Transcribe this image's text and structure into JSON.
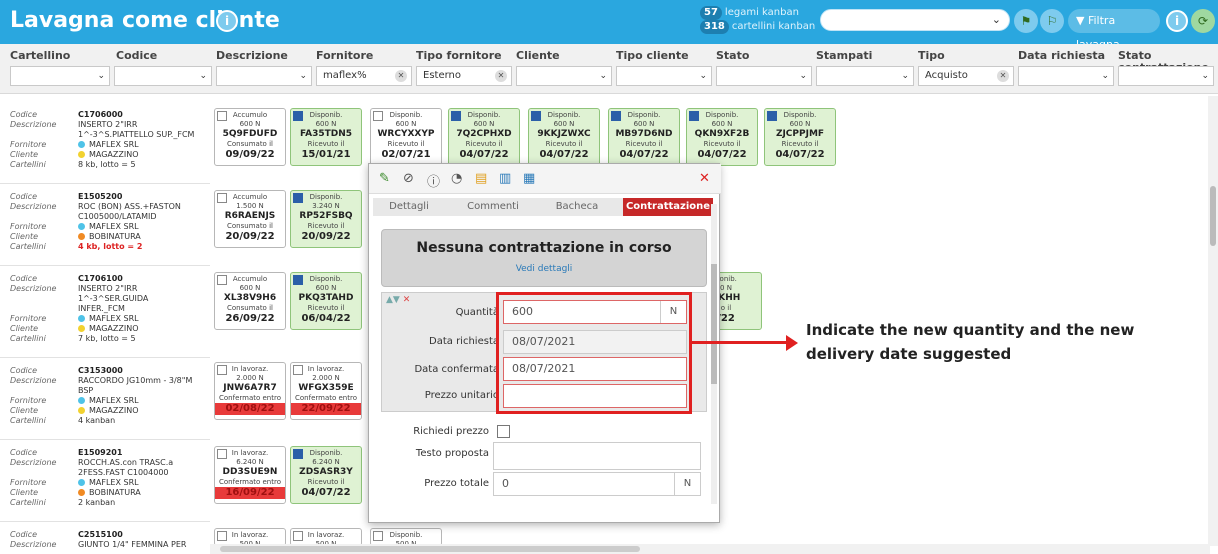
{
  "header": {
    "title": "Lavagna come cliente",
    "legami_count": "57",
    "legami_label": "legami kanban",
    "cartellini_count": "318",
    "cartellini_label": "cartellini kanban",
    "filter_button": "Filtra lavagna"
  },
  "filters": {
    "columns": [
      "Cartellino",
      "Codice",
      "Descrizione",
      "Fornitore",
      "Tipo fornitore",
      "Cliente",
      "Tipo cliente",
      "Stato",
      "Stampati",
      "Tipo",
      "Data richiesta",
      "Stato contrattazione"
    ],
    "values": {
      "fornitore": "maflex%",
      "tipo_fornitore": "Esterno",
      "tipo": "Acquisto"
    }
  },
  "labels": {
    "codice": "Codice",
    "descrizione": "Descrizione",
    "fornitore": "Fornitore",
    "cliente": "Cliente",
    "cartellini": "Cartellini"
  },
  "parts": [
    {
      "code": "C1706000",
      "desc1": "INSERTO 2\"IRR",
      "desc2": "1^-3^S.PIATTELLO SUP._FCM",
      "fornitore": "MAFLEX SRL",
      "cliente": "MAGAZZINO",
      "cliente_color": "#f2d230",
      "cartellini": "8 kb, lotto = 5",
      "cart_red": false
    },
    {
      "code": "E1505200",
      "desc1": "ROC (BON) ASS.+FASTON",
      "desc2": "C1005000/LATAMID",
      "fornitore": "MAFLEX SRL",
      "cliente": "BOBINATURA",
      "cliente_color": "#f08a24",
      "cartellini": "4 kb, lotto = 2",
      "cart_red": true
    },
    {
      "code": "C1706100",
      "desc1": "INSERTO 2\"IRR",
      "desc2": "1^-3^SER.GUIDA",
      "desc3": "INFER._FCM",
      "fornitore": "MAFLEX SRL",
      "cliente": "MAGAZZINO",
      "cliente_color": "#f2d230",
      "cartellini": "7 kb, lotto = 5",
      "cart_red": false
    },
    {
      "code": "C3153000",
      "desc1": "RACCORDO JG10mm - 3/8\"M",
      "desc2": "BSP",
      "fornitore": "MAFLEX SRL",
      "cliente": "MAGAZZINO",
      "cliente_color": "#f2d230",
      "cartellini": "4 kanban",
      "cart_red": false
    },
    {
      "code": "E1509201",
      "desc1": "ROCCH.AS.con TRASC.a",
      "desc2": "2FESS.FAST C1004000",
      "fornitore": "MAFLEX SRL",
      "cliente": "BOBINATURA",
      "cliente_color": "#f08a24",
      "cartellini": "2 kanban",
      "cart_red": false
    },
    {
      "code": "C2515100",
      "desc1": "GIUNTO 1/4\" FEMMINA PER"
    }
  ],
  "cards_row1": [
    {
      "status": "Accumulo",
      "qty": "600 N",
      "code": "5Q9FDUFD",
      "sub": "Consumato il",
      "date": "09/09/22",
      "style": "white"
    },
    {
      "status": "Disponib.",
      "qty": "600 N",
      "code": "FA35TDN5",
      "sub": "Ricevuto il",
      "date": "15/01/21",
      "style": "green"
    },
    {
      "status": "Disponib.",
      "qty": "600 N",
      "code": "WRCYXXYP",
      "sub": "Ricevuto il",
      "date": "02/07/21",
      "style": "white"
    },
    {
      "status": "Disponib.",
      "qty": "600 N",
      "code": "7Q2CPHXD",
      "sub": "Ricevuto il",
      "date": "04/07/22",
      "style": "green"
    },
    {
      "status": "Disponib.",
      "qty": "600 N",
      "code": "9KKJZWXC",
      "sub": "Ricevuto il",
      "date": "04/07/22",
      "style": "green"
    },
    {
      "status": "Disponib.",
      "qty": "600 N",
      "code": "MB97D6ND",
      "sub": "Ricevuto il",
      "date": "04/07/22",
      "style": "green"
    },
    {
      "status": "Disponib.",
      "qty": "600 N",
      "code": "QKN9XF2B",
      "sub": "Ricevuto il",
      "date": "04/07/22",
      "style": "green"
    },
    {
      "status": "Disponib.",
      "qty": "600 N",
      "code": "ZJCPPJMF",
      "sub": "Ricevuto il",
      "date": "04/07/22",
      "style": "green"
    }
  ],
  "cards_row2": [
    {
      "status": "Accumulo",
      "qty": "1.500 N",
      "code": "R6RAENJS",
      "sub": "Consumato il",
      "date": "20/09/22",
      "style": "white"
    },
    {
      "status": "Disponib.",
      "qty": "3.240 N",
      "code": "RP52FSBQ",
      "sub": "Ricevuto il",
      "date": "20/09/22",
      "style": "green"
    }
  ],
  "cards_row3": [
    {
      "status": "Accumulo",
      "qty": "600 N",
      "code": "XL38V9H6",
      "sub": "Consumato il",
      "date": "26/09/22",
      "style": "white"
    },
    {
      "status": "Disponib.",
      "qty": "600 N",
      "code": "PKQ3TAHD",
      "sub": "Ricevuto il",
      "date": "06/04/22",
      "style": "green"
    },
    {
      "status": "ponib.",
      "qty": "0 N",
      "code": "YKHH",
      "sub": "o il",
      "date": "/22",
      "style": "green"
    }
  ],
  "cards_row4": [
    {
      "status": "In lavoraz.",
      "qty": "2.000 N",
      "code": "JNW6A7R7",
      "sub": "Confermato entro",
      "date": "02/08/22",
      "style": "red"
    },
    {
      "status": "In lavoraz.",
      "qty": "2.000 N",
      "code": "WFGX359E",
      "sub": "Confermato entro",
      "date": "22/09/22",
      "style": "red"
    }
  ],
  "cards_row5": [
    {
      "status": "In lavoraz.",
      "qty": "6.240 N",
      "code": "DD3SUE9N",
      "sub": "Confermato entro",
      "date": "16/09/22",
      "style": "red"
    },
    {
      "status": "Disponib.",
      "qty": "6.240 N",
      "code": "ZDSASR3Y",
      "sub": "Ricevuto il",
      "date": "04/07/22",
      "style": "green"
    }
  ],
  "cards_row6": [
    {
      "status": "In lavoraz.",
      "qty": "500 N"
    },
    {
      "status": "In lavoraz.",
      "qty": "500 N"
    },
    {
      "status": "Disponib.",
      "qty": "500 N"
    }
  ],
  "modal": {
    "tabs": [
      "Dettagli",
      "Commenti",
      "Bacheca",
      "Contrattazione"
    ],
    "active_tab": "Contrattazione",
    "banner_title": "Nessuna contrattazione in corso",
    "banner_link": "Vedi dettagli",
    "quantita_label": "Quantità",
    "quantita_value": "600",
    "quantita_unit": "N",
    "data_richiesta_label": "Data richiesta",
    "data_richiesta_value": "08/07/2021",
    "data_confermata_label": "Data confermata",
    "data_confermata_value": "08/07/2021",
    "prezzo_unitario_label": "Prezzo unitario",
    "richiedi_prezzo_label": "Richiedi prezzo",
    "testo_proposta_label": "Testo proposta",
    "prezzo_totale_label": "Prezzo totale",
    "prezzo_totale_value": "0",
    "prezzo_totale_unit": "N"
  },
  "annotation": "Indicate the new quantity and the new delivery date suggested",
  "colors": {
    "header": "#2aa7df",
    "active_tab": "#c62828",
    "highlight": "#e02020",
    "card_green": "#dff2d3",
    "fornitore_dot": "#4fc3e8"
  }
}
